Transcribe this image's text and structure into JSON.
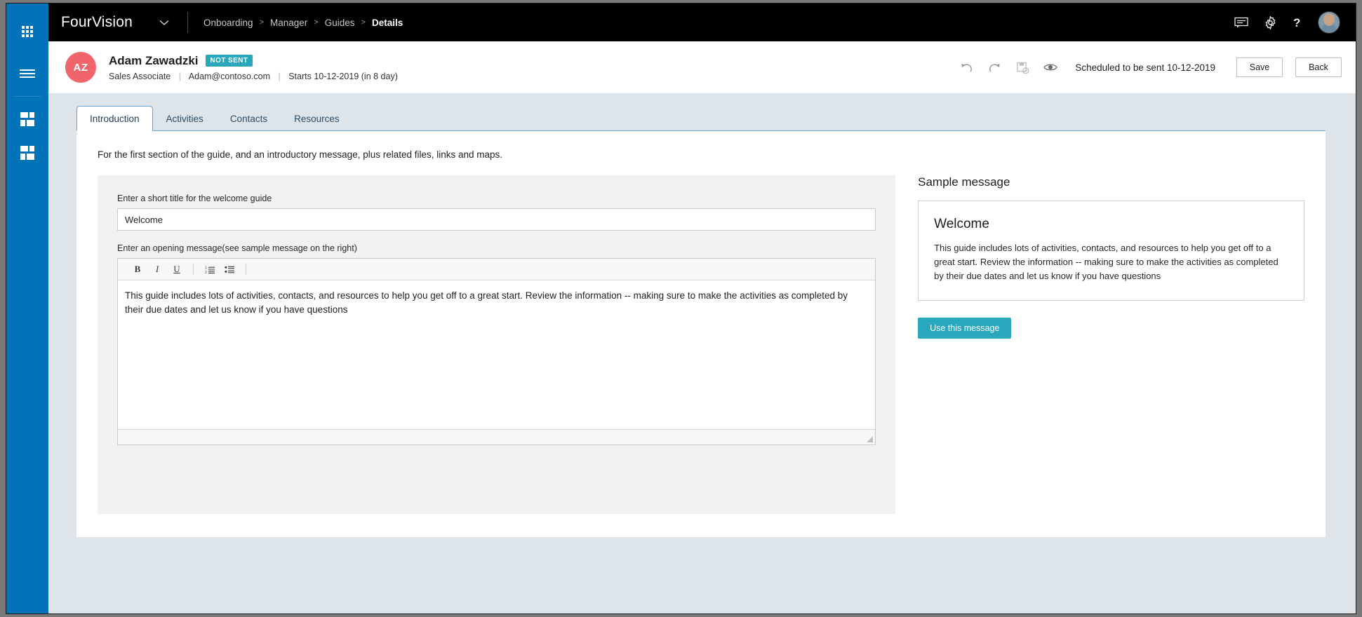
{
  "rail": {
    "items": [
      {
        "name": "app-launcher",
        "icon": "waffle-icon"
      },
      {
        "name": "menu",
        "icon": "hamburger-icon"
      },
      {
        "name": "workspace-1",
        "icon": "tiles-icon"
      },
      {
        "name": "workspace-2",
        "icon": "tiles-icon"
      }
    ]
  },
  "topbar": {
    "brand": "FourVision",
    "caret_icon": "chevron-down-icon",
    "breadcrumb": [
      {
        "label": "Onboarding",
        "active": false
      },
      {
        "label": "Manager",
        "active": false
      },
      {
        "label": "Guides",
        "active": false
      },
      {
        "label": "Details",
        "active": true
      }
    ],
    "separator": ">",
    "icons": [
      "feedback-icon",
      "gear-icon",
      "help-icon",
      "avatar"
    ]
  },
  "record": {
    "initials": "AZ",
    "name": "Adam Zawadzki",
    "status_badge": "NOT SENT",
    "job_title": "Sales Associate",
    "email": "Adam@contoso.com",
    "start": "Starts 10-12-2019 (in 8 day)",
    "separator": "|",
    "actions": [
      "undo-icon",
      "redo-icon",
      "save-status-icon",
      "preview-icon"
    ],
    "scheduled_text": "Scheduled to be sent 10-12-2019",
    "save_label": "Save",
    "back_label": "Back"
  },
  "tabs": [
    {
      "label": "Introduction",
      "active": true
    },
    {
      "label": "Activities",
      "active": false
    },
    {
      "label": "Contacts",
      "active": false
    },
    {
      "label": "Resources",
      "active": false
    }
  ],
  "main": {
    "intro_line": "For the first section of the guide, and an introductory message, plus related files, links and maps.",
    "title_field": {
      "label": "Enter a short title for the welcome guide",
      "value": "Welcome",
      "placeholder": ""
    },
    "message_field": {
      "label": "Enter an opening message(see sample message on the right)",
      "value": "This guide includes lots of activities, contacts, and resources to help you get off to a great start. Review the information -- making sure to make the activities as completed by their due dates and let us know if you have questions"
    },
    "editor_toolbar": {
      "bold": "B",
      "italic": "I",
      "underline": "U",
      "ordered_list": "ordered-list-icon",
      "bullet_list": "bullet-list-icon"
    }
  },
  "sample": {
    "title": "Sample message",
    "heading": "Welcome",
    "body": "This guide includes lots of activities, contacts, and resources to help you get off to a great start. Review the information -- making sure to make the activities as completed by their due dates and let us know if you have questions",
    "button_label": "Use this message"
  },
  "colors": {
    "rail_blue": "#0072b8",
    "topbar_black": "#000000",
    "page_bg": "#dde5eb",
    "accent_teal": "#29a8bd",
    "avatar_red": "#f0656b",
    "tab_border": "#6aa4cc"
  }
}
